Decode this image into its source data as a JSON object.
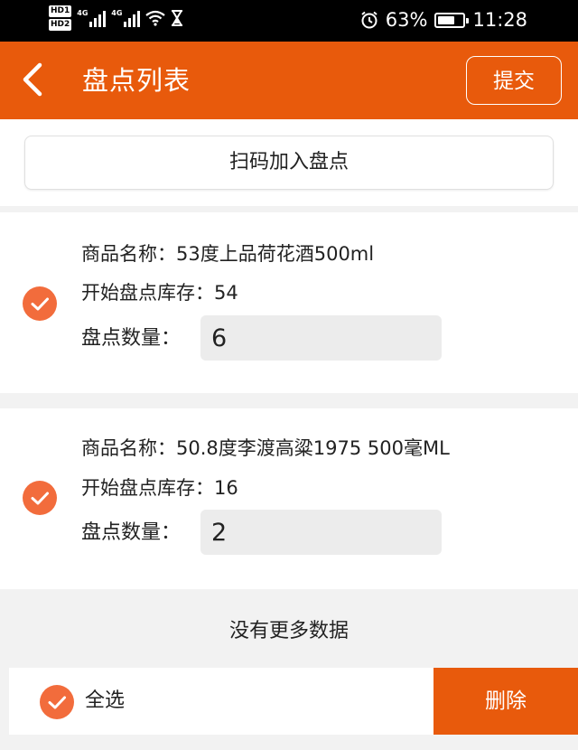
{
  "status_bar": {
    "hd1": "HD1",
    "hd2": "HD2",
    "net1": "4G",
    "net2": "4G",
    "battery_percent": "63%",
    "time": "11:28",
    "icons": [
      "signal-icon",
      "wifi-icon",
      "hourglass-icon",
      "alarm-icon",
      "battery-icon"
    ]
  },
  "header": {
    "title": "盘点列表",
    "submit_label": "提交",
    "back_icon": "chevron-left-icon"
  },
  "scan_button": {
    "label": "扫码加入盘点"
  },
  "items": [
    {
      "name_label": "商品名称：",
      "name": "53度上品荷花酒500ml",
      "stock_label": "开始盘点库存：",
      "stock": "54",
      "qty_label": "盘点数量：",
      "qty": "6",
      "checked": true
    },
    {
      "name_label": "商品名称：",
      "name": "50.8度李渡高粱1975 500毫ML",
      "stock_label": "开始盘点库存：",
      "stock": "16",
      "qty_label": "盘点数量：",
      "qty": "2",
      "checked": true
    }
  ],
  "list_footer": {
    "no_more": "没有更多数据"
  },
  "bottom_bar": {
    "select_all_label": "全选",
    "select_all_checked": true,
    "delete_label": "删除"
  },
  "colors": {
    "brand": "#e85a0c",
    "check": "#f26c3c",
    "input_bg": "#ececec",
    "page_bg": "#f2f2f2"
  }
}
